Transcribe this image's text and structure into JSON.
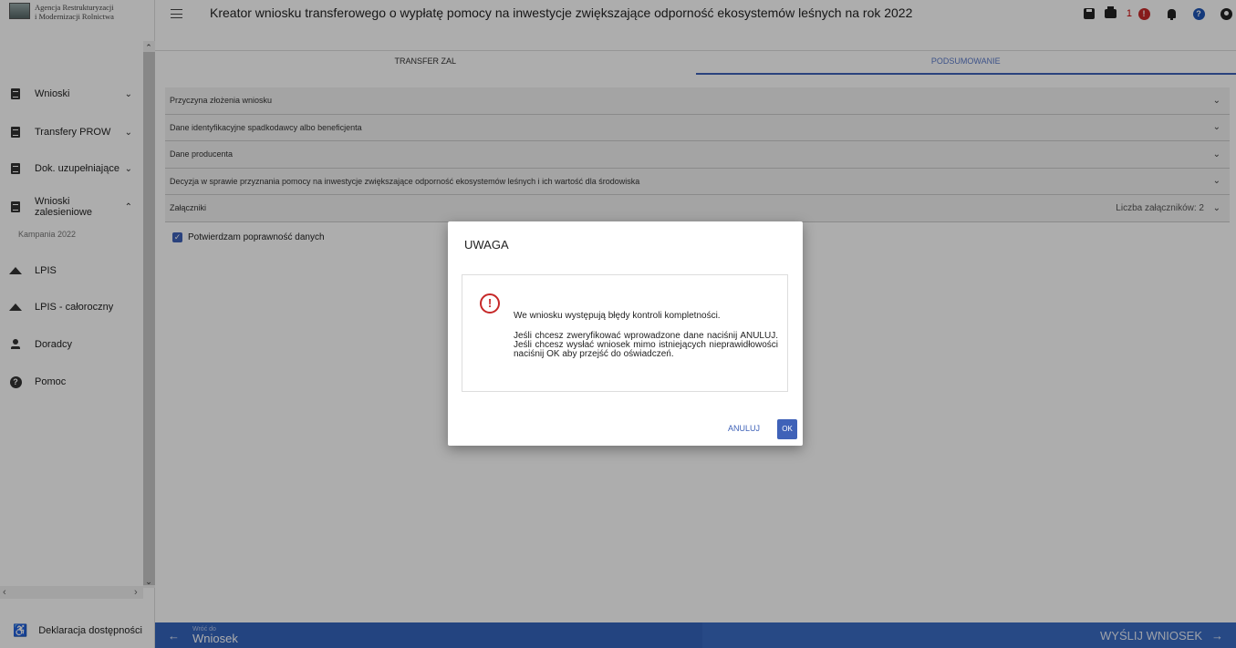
{
  "logo": {
    "line1": "Agencja Restrukturyzacji",
    "line2": "i Modernizacji Rolnictwa"
  },
  "sidebar": {
    "items": [
      {
        "label": "Wnioski",
        "icon": "document-icon",
        "chevron": "⌄"
      },
      {
        "label": "Transfery PROW",
        "icon": "document-icon",
        "chevron": "⌄"
      },
      {
        "label": "Dok. uzupełniające",
        "icon": "document-icon",
        "chevron": "⌄"
      },
      {
        "label": "Wnioski zalesieniowe",
        "icon": "document-icon",
        "chevron": "⌃"
      },
      {
        "label": "LPIS",
        "icon": "mountain-icon"
      },
      {
        "label": "LPIS - całoroczny",
        "icon": "mountain-icon"
      },
      {
        "label": "Doradcy",
        "icon": "person-icon"
      },
      {
        "label": "Pomoc",
        "icon": "help-icon"
      }
    ],
    "campaign": "Kampania 2022",
    "declaration": "Deklaracja dostępności"
  },
  "header": {
    "title": "Kreator wniosku transferowego o wypłatę pomocy na inwestycje zwiększające odporność ekosystemów leśnych na rok 2022",
    "error_count": "1"
  },
  "tabs": [
    "TRANSFER ZAL",
    "PODSUMOWANIE"
  ],
  "panels": [
    {
      "label": "Przyczyna złożenia wniosku"
    },
    {
      "label": "Dane identyfikacyjne spadkodawcy albo beneficjenta"
    },
    {
      "label": "Dane producenta"
    },
    {
      "label": "Decyzja w sprawie przyznania pomocy na inwestycje zwiększające odporność ekosystemów leśnych i ich wartość dla środowiska"
    },
    {
      "label": "Załączniki",
      "extra": "Liczba załączników: 2"
    }
  ],
  "confirm_label": "Potwierdzam poprawność danych",
  "bottom": {
    "back_small": "Wróć do",
    "back_label": "Wniosek",
    "send_label": "WYŚLIJ WNIOSEK"
  },
  "dialog": {
    "title": "UWAGA",
    "message1": "We wniosku występują błędy kontroli kompletności.",
    "message2": "Jeśli chcesz zweryfikować wprowadzone dane naciśnij ANULUJ. Jeśli chcesz wysłać wniosek mimo istniejących nieprawidłowości naciśnij OK aby przejść do oświadczeń.",
    "cancel_label": "ANULUJ",
    "ok_label": "OK"
  },
  "colors": {
    "accent": "#3f62b8",
    "error": "#c62828",
    "bottom_bar": "#3a6cc4"
  }
}
